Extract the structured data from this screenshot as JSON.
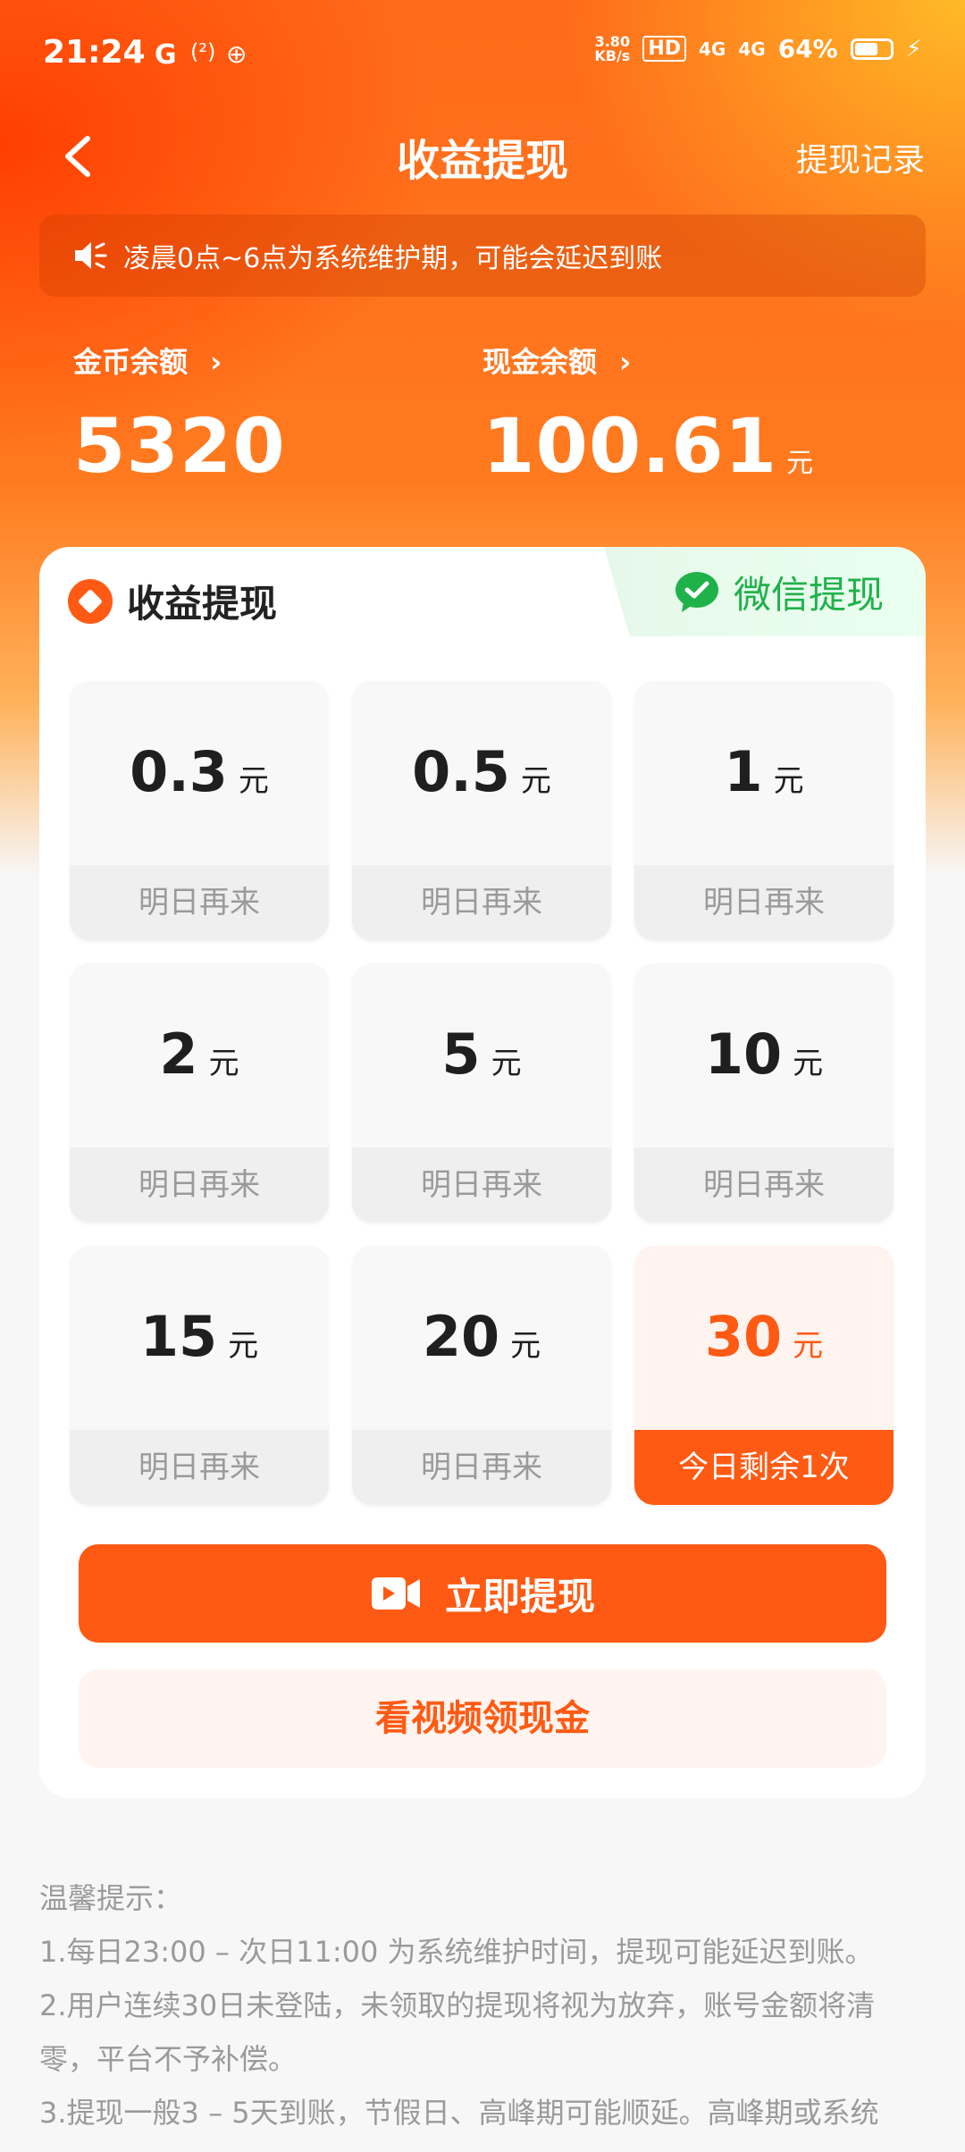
{
  "status_bar": {
    "time": "21:24",
    "left_icons": [
      "G",
      "(²)",
      "⊕"
    ],
    "net_speed": "3.80",
    "net_unit": "KB/s",
    "hd": "HD",
    "signal1": "4G",
    "signal2": "4G",
    "battery": "64%"
  },
  "header": {
    "title": "收益提现",
    "record_link": "提现记录"
  },
  "notice": "凌晨0点~6点为系统维护期，可能会延迟到账",
  "balances": {
    "coin_label": "金币余额",
    "coin_value": "5320",
    "cash_label": "现金余额",
    "cash_value": "100.61",
    "cash_unit": "元"
  },
  "card": {
    "title": "收益提现",
    "wechat_tab": "微信提现",
    "unit": "元",
    "options": [
      {
        "amount": "0.3",
        "status": "明日再来",
        "active": false
      },
      {
        "amount": "0.5",
        "status": "明日再来",
        "active": false
      },
      {
        "amount": "1",
        "status": "明日再来",
        "active": false
      },
      {
        "amount": "2",
        "status": "明日再来",
        "active": false
      },
      {
        "amount": "5",
        "status": "明日再来",
        "active": false
      },
      {
        "amount": "10",
        "status": "明日再来",
        "active": false
      },
      {
        "amount": "15",
        "status": "明日再来",
        "active": false
      },
      {
        "amount": "20",
        "status": "明日再来",
        "active": false
      },
      {
        "amount": "30",
        "status": "今日剩余1次",
        "active": true
      }
    ],
    "withdraw_button": "立即提现",
    "video_button": "看视频领现金"
  },
  "tips": {
    "heading": "温馨提示：",
    "items": [
      "1.每日23:00 – 次日11:00 为系统维护时间，提现可能延迟到账。",
      "2.用户连续30日未登陆，未领取的提现将视为放弃，账号金额将清",
      "零，平台不予补偿。",
      "3.提现一般3 – 5天到账，节假日、高峰期可能顺延。高峰期或系统"
    ]
  },
  "colors": {
    "accent": "#ff5a14",
    "wechat": "#1fb24a"
  }
}
